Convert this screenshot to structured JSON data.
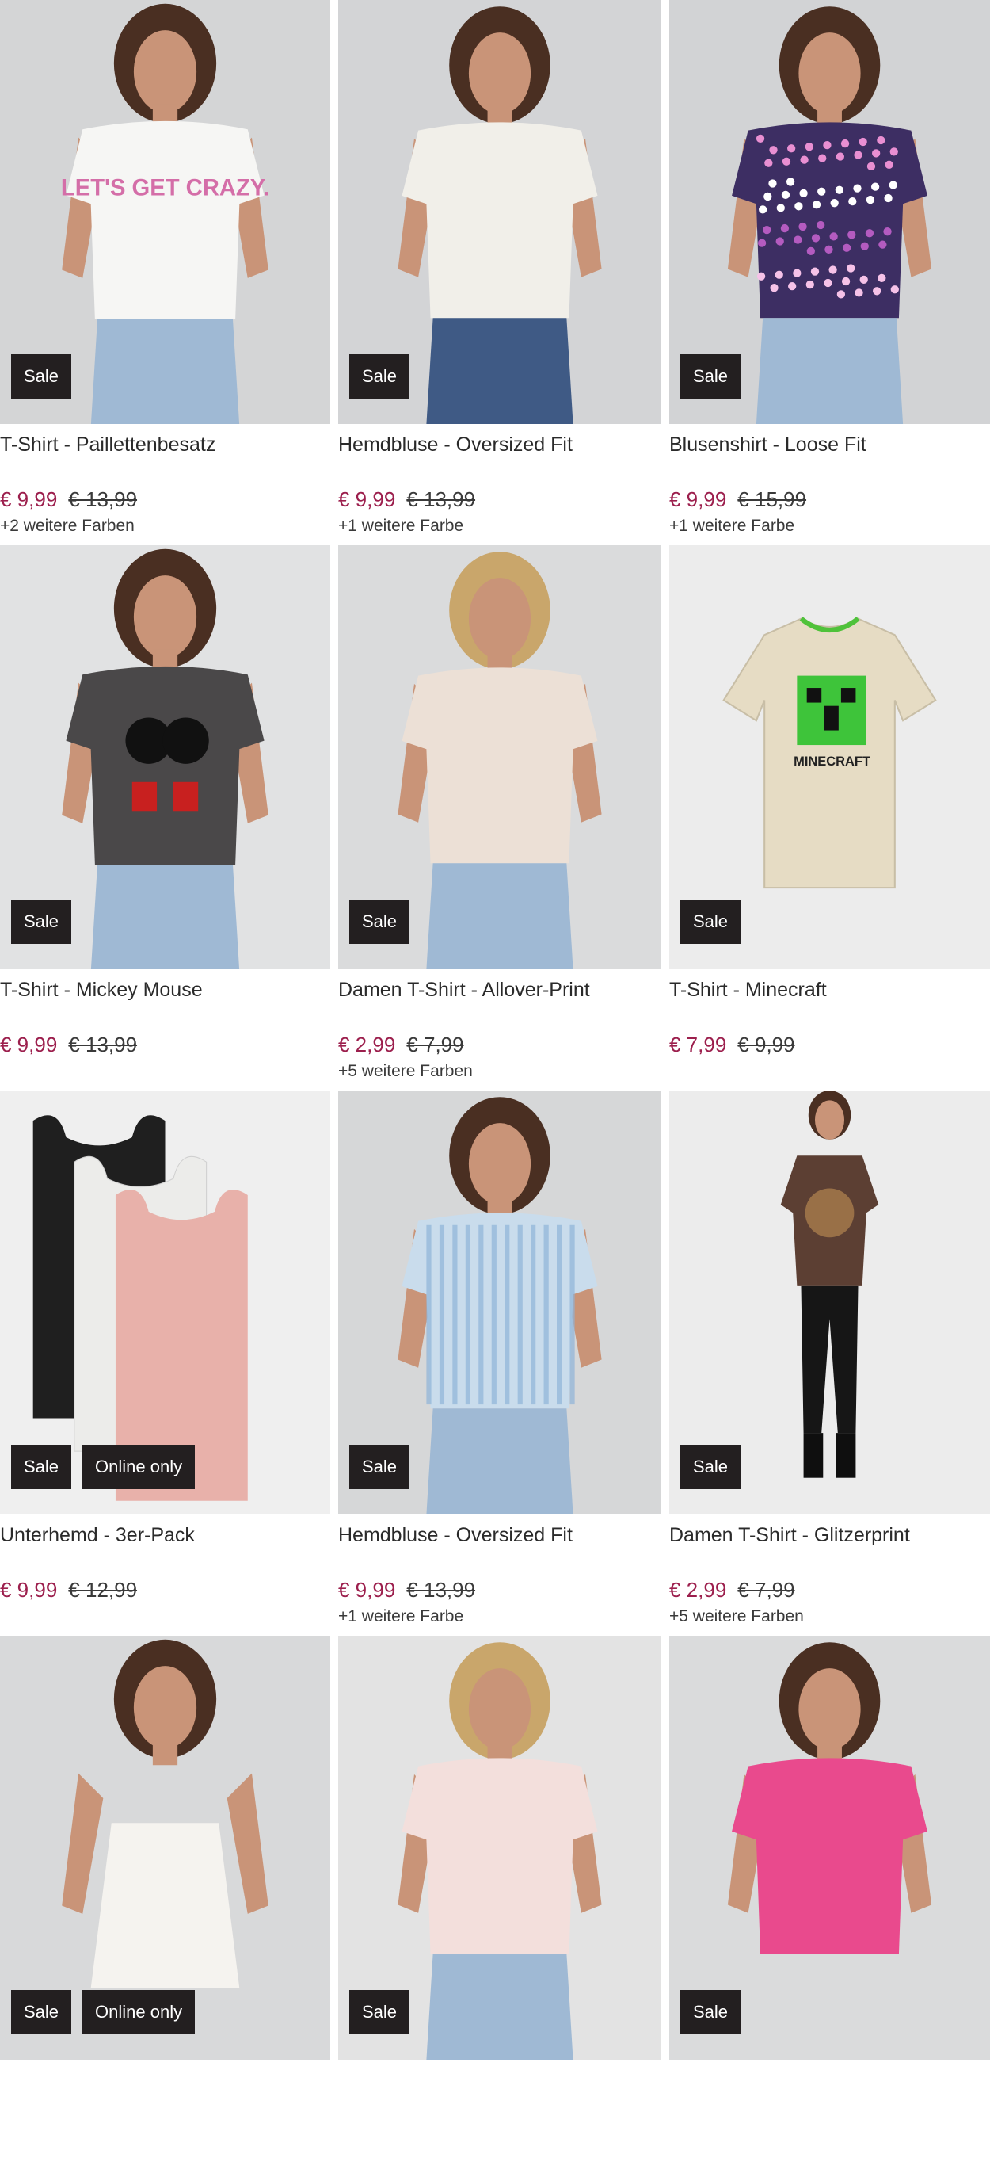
{
  "products": [
    {
      "title": "T-Shirt - Paillettenbesatz",
      "price": "€ 9,99",
      "old_price": "€ 13,99",
      "colors": "+2 weitere Farben",
      "badges": [
        "Sale"
      ],
      "image": "woman-white-tshirt-glitter-lettering",
      "shirt_color": "#f6f6f4",
      "bg_color": "#d4d5d6",
      "print_text": "LET'S GET CRAZY."
    },
    {
      "title": "Hemdbluse - Oversized Fit",
      "price": "€ 9,99",
      "old_price": "€ 13,99",
      "colors": "+1 weitere Farbe",
      "badges": [
        "Sale"
      ],
      "image": "woman-white-blouse",
      "shirt_color": "#f1efe9",
      "bg_color": "#d3d4d6",
      "print_text": ""
    },
    {
      "title": "Blusenshirt - Loose Fit",
      "price": "€ 9,99",
      "old_price": "€ 15,99",
      "colors": "+1 weitere Farbe",
      "badges": [
        "Sale"
      ],
      "image": "woman-floral-blouse",
      "shirt_color": "#3d2e63",
      "bg_color": "#d2d3d5",
      "print_text": ""
    },
    {
      "title": "T-Shirt - Mickey Mouse",
      "price": "€ 9,99",
      "old_price": "€ 13,99",
      "colors": "",
      "badges": [
        "Sale"
      ],
      "image": "woman-grey-mickey-tshirt",
      "shirt_color": "#4a4849",
      "bg_color": "#e1e2e3",
      "print_text": ""
    },
    {
      "title": "Damen T-Shirt - Allover-Print",
      "price": "€ 2,99",
      "old_price": "€ 7,99",
      "colors": "+5 weitere Farben",
      "badges": [
        "Sale"
      ],
      "image": "woman-beige-print-tshirt",
      "shirt_color": "#ece0d6",
      "bg_color": "#dadbdc",
      "print_text": ""
    },
    {
      "title": "T-Shirt - Minecraft",
      "price": "€ 7,99",
      "old_price": "€ 9,99",
      "colors": "",
      "badges": [
        "Sale"
      ],
      "image": "kids-minecraft-tshirt",
      "shirt_color": "#e6dcc4",
      "bg_color": "#ececec",
      "print_text": "MINECRAFT"
    },
    {
      "title": "Unterhemd - 3er-Pack",
      "price": "€ 9,99",
      "old_price": "€ 12,99",
      "colors": "",
      "badges": [
        "Sale",
        "Online only"
      ],
      "image": "three-tank-tops",
      "shirt_color": "#e8b1aa",
      "bg_color": "#efefef",
      "print_text": ""
    },
    {
      "title": "Hemdbluse - Oversized Fit",
      "price": "€ 9,99",
      "old_price": "€ 13,99",
      "colors": "+1 weitere Farbe",
      "badges": [
        "Sale"
      ],
      "image": "woman-striped-blouse",
      "shirt_color": "#c9dcec",
      "bg_color": "#d6d7d8",
      "print_text": ""
    },
    {
      "title": "Damen T-Shirt - Glitzerprint",
      "price": "€ 2,99",
      "old_price": "€ 7,99",
      "colors": "+5 weitere Farben",
      "badges": [
        "Sale"
      ],
      "image": "woman-brown-tshirt-full-body",
      "shirt_color": "#5c3f33",
      "bg_color": "#ececec",
      "print_text": ""
    },
    {
      "title": "",
      "price": "",
      "old_price": "",
      "colors": "",
      "badges": [
        "Sale",
        "Online only"
      ],
      "image": "woman-white-satin-top",
      "shirt_color": "#f5f3ef",
      "bg_color": "#d8d9da",
      "print_text": ""
    },
    {
      "title": "",
      "price": "",
      "old_price": "",
      "colors": "",
      "badges": [
        "Sale"
      ],
      "image": "woman-pink-dotted-tshirt",
      "shirt_color": "#f3dfdc",
      "bg_color": "#e3e3e3",
      "print_text": ""
    },
    {
      "title": "",
      "price": "",
      "old_price": "",
      "colors": "",
      "badges": [
        "Sale"
      ],
      "image": "woman-pink-tshirt",
      "shirt_color": "#e94a8d",
      "bg_color": "#dadbdc",
      "print_text": ""
    }
  ]
}
